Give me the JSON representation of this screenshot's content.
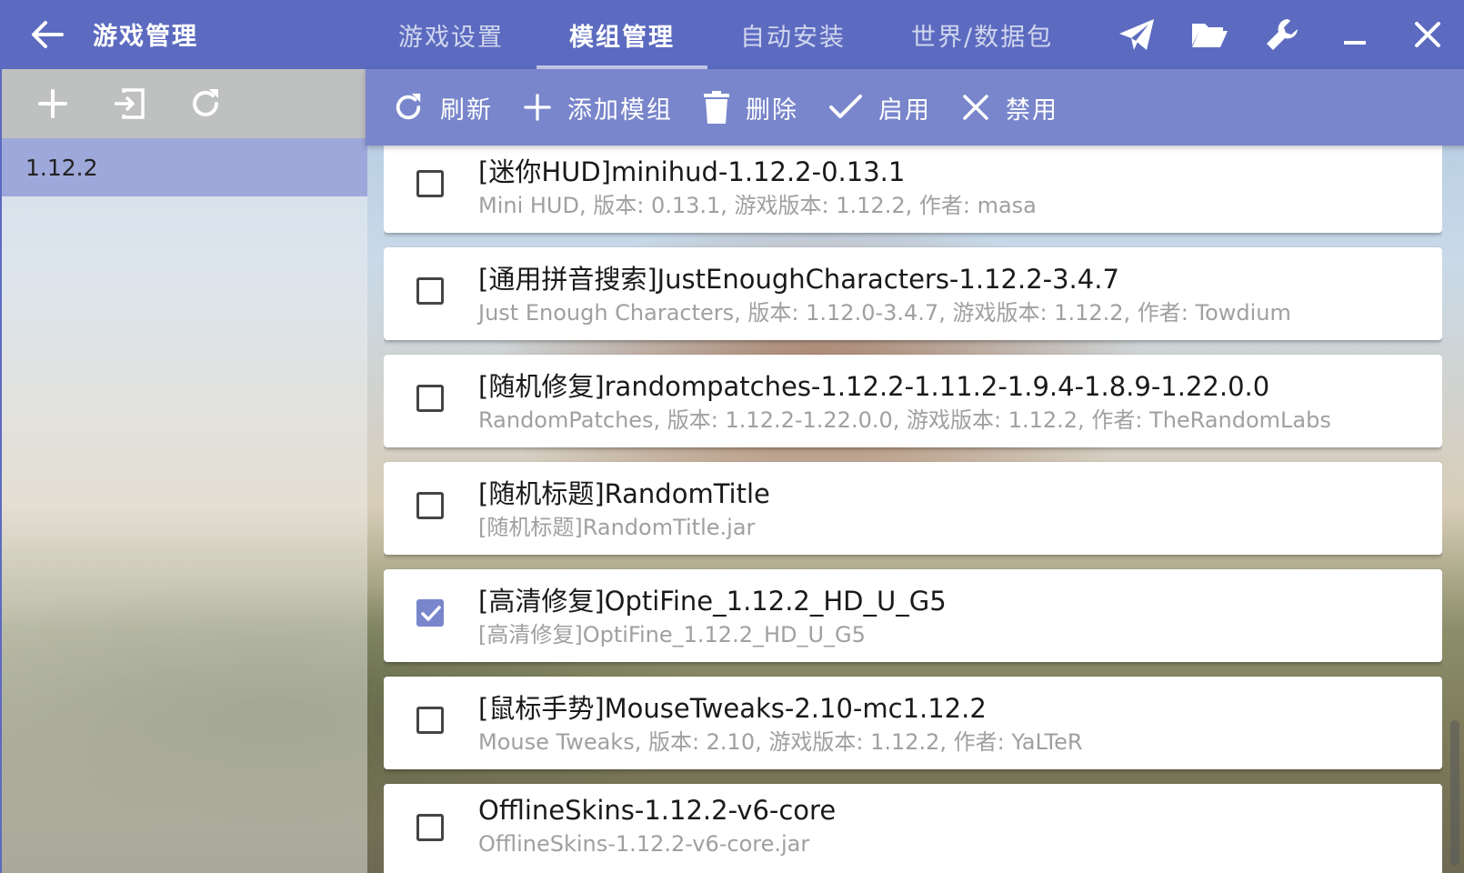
{
  "header": {
    "title": "游戏管理",
    "back_icon": "arrow-left-icon",
    "tabs": [
      {
        "label": "游戏设置",
        "active": false
      },
      {
        "label": "模组管理",
        "active": true
      },
      {
        "label": "自动安装",
        "active": false
      },
      {
        "label": "世界/数据包",
        "active": false
      }
    ],
    "icons": [
      "send-icon",
      "folder-open-icon",
      "wrench-icon",
      "minimize-icon",
      "close-icon"
    ]
  },
  "sidebar": {
    "tools": [
      "plus-icon",
      "import-icon",
      "refresh-icon"
    ],
    "versions": [
      {
        "label": "1.12.2",
        "selected": true
      }
    ]
  },
  "toolbar": {
    "refresh_label": "刷新",
    "add_label": "添加模组",
    "delete_label": "删除",
    "enable_label": "启用",
    "disable_label": "禁用"
  },
  "mods": [
    {
      "title": "[迷你HUD]minihud-1.12.2-0.13.1",
      "subtitle": "Mini HUD, 版本: 0.13.1, 游戏版本: 1.12.2, 作者: masa",
      "checked": false
    },
    {
      "title": "[通用拼音搜索]JustEnoughCharacters-1.12.2-3.4.7",
      "subtitle": "Just Enough Characters, 版本: 1.12.0-3.4.7, 游戏版本: 1.12.2, 作者: Towdium",
      "checked": false
    },
    {
      "title": "[随机修复]randompatches-1.12.2-1.11.2-1.9.4-1.8.9-1.22.0.0",
      "subtitle": "RandomPatches, 版本: 1.12.2-1.22.0.0, 游戏版本: 1.12.2, 作者: TheRandomLabs",
      "checked": false
    },
    {
      "title": "[随机标题]RandomTitle",
      "subtitle": "[随机标题]RandomTitle.jar",
      "checked": false
    },
    {
      "title": "[高清修复]OptiFine_1.12.2_HD_U_G5",
      "subtitle": "[高清修复]OptiFine_1.12.2_HD_U_G5",
      "checked": true
    },
    {
      "title": "[鼠标手势]MouseTweaks-2.10-mc1.12.2",
      "subtitle": "Mouse Tweaks, 版本: 2.10, 游戏版本: 1.12.2, 作者: YaLTeR",
      "checked": false
    },
    {
      "title": "OfflineSkins-1.12.2-v6-core",
      "subtitle": "OfflineSkins-1.12.2-v6-core.jar",
      "checked": false
    }
  ],
  "colors": {
    "primary": "#5c6bc0",
    "toolbar": "#7986cb",
    "selected": "#9fa8da"
  }
}
